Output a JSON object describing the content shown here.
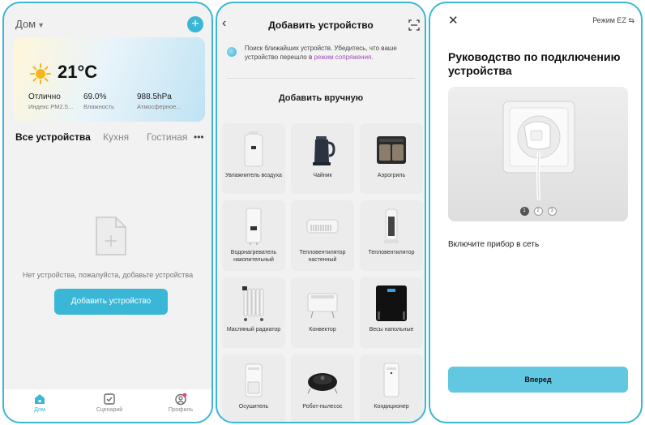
{
  "home": {
    "home_name": "Дом",
    "weather": {
      "temperature": "21°C",
      "air_quality_value": "Отлично",
      "air_quality_label": "Индекс PM2.5...",
      "humidity_value": "69.0%",
      "humidity_label": "Влажность",
      "pressure_value": "988.5hPa",
      "pressure_label": "Атмосферное..."
    },
    "tabs": [
      "Все устройства",
      "Кухня",
      "Гостиная"
    ],
    "more": "•••",
    "empty_text": "Нет устройства, пожалуйста, добавьте устройства",
    "add_button": "Добавить устройство",
    "nav": [
      "Дом",
      "Сценарий",
      "Профиль"
    ]
  },
  "add_device": {
    "title": "Добавить устройство",
    "search_text": "Поиск ближайших устройств. Убедитесь, что ваше устройство перешло в",
    "search_link": "режим сопряжения",
    "search_tail": ".",
    "manual_title": "Добавить вручную",
    "devices": [
      {
        "name": "Увлажнитель воздуха",
        "icon": "humidifier-icon"
      },
      {
        "name": "Чайник",
        "icon": "kettle-icon"
      },
      {
        "name": "Аэрогриль",
        "icon": "air-fryer-icon"
      },
      {
        "name": "Водонагреватель накопительный",
        "icon": "water-heater-icon"
      },
      {
        "name": "Тепловентилятор настенный",
        "icon": "wall-heater-icon"
      },
      {
        "name": "Тепловентилятор",
        "icon": "fan-heater-icon"
      },
      {
        "name": "Масляный радиатор",
        "icon": "oil-radiator-icon"
      },
      {
        "name": "Конвектор",
        "icon": "convector-icon"
      },
      {
        "name": "Весы напольные",
        "icon": "scale-icon"
      },
      {
        "name": "Осушитель",
        "icon": "dehumidifier-icon"
      },
      {
        "name": "Робот-пылесос",
        "icon": "robot-vacuum-icon"
      },
      {
        "name": "Кондиционер",
        "icon": "air-conditioner-icon"
      }
    ]
  },
  "guide": {
    "mode_label": "Режим EZ",
    "title": "Руководство по подключению устройства",
    "pages": [
      "1",
      "2",
      "3"
    ],
    "current_page": 1,
    "instruction": "Включите прибор в сеть",
    "next_button": "Вперед"
  },
  "colors": {
    "accent": "#3ab7d6",
    "link": "#a24fbf"
  }
}
